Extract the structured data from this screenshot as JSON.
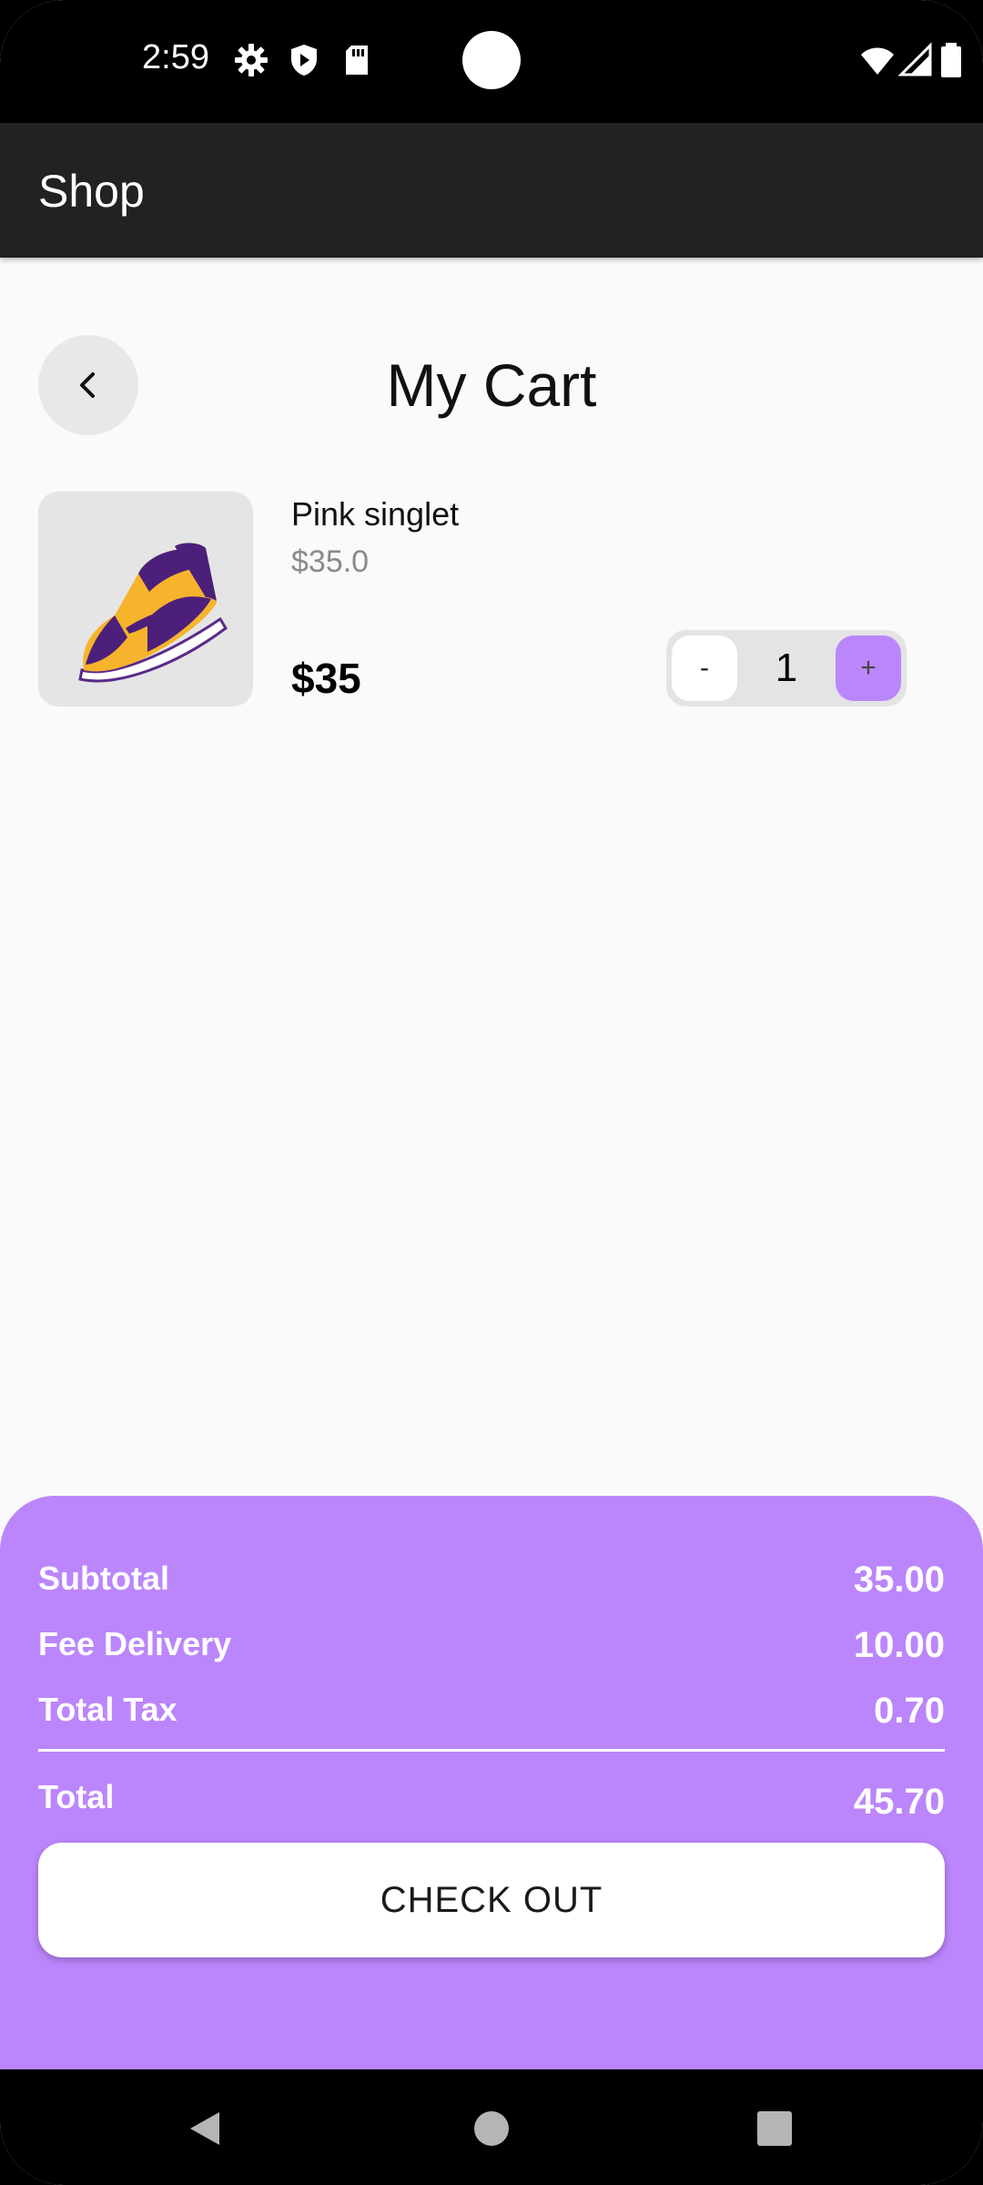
{
  "status_bar": {
    "time": "2:59",
    "icons": [
      "gear-icon",
      "shield-icon",
      "sd-card-icon",
      "wifi-icon",
      "signal-icon",
      "battery-icon"
    ]
  },
  "app_bar": {
    "title": "Shop"
  },
  "cart": {
    "title": "My Cart",
    "items": [
      {
        "name": "Pink singlet",
        "unit_price": "$35.0",
        "total": "$35",
        "quantity": "1",
        "minus_label": "-",
        "plus_label": "+",
        "image": "sneaker-image"
      }
    ]
  },
  "summary": {
    "subtotal_label": "Subtotal",
    "subtotal_value": "35.00",
    "delivery_label": "Fee Delivery",
    "delivery_value": "10.00",
    "tax_label": "Total Tax",
    "tax_value": "0.70",
    "total_label": "Total",
    "total_value": "45.70",
    "checkout_label": "CHECK OUT"
  },
  "colors": {
    "accent": "#bb86fc",
    "app_bar": "#222222",
    "background": "#fafafa"
  }
}
